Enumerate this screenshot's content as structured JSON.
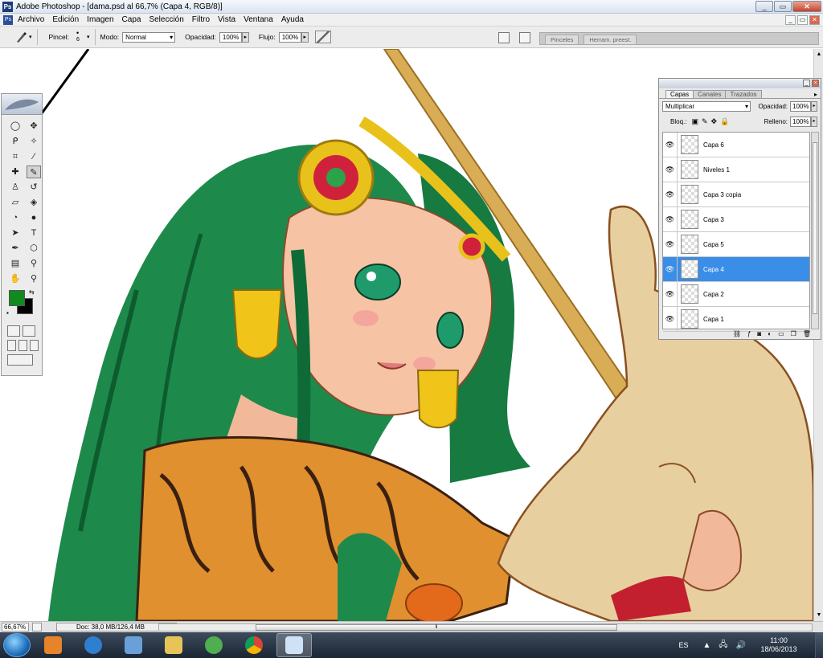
{
  "window": {
    "title": "Adobe Photoshop - [dama.psd al 66,7% (Capa 4, RGB/8)]",
    "controls": [
      "_",
      "▭",
      "✕"
    ]
  },
  "menubar": {
    "items": [
      "Archivo",
      "Edición",
      "Imagen",
      "Capa",
      "Selección",
      "Filtro",
      "Vista",
      "Ventana",
      "Ayuda"
    ],
    "doc_controls": [
      "_",
      "▭",
      "✕"
    ]
  },
  "options_bar": {
    "brush_label": "Pincel:",
    "brush_size": "6",
    "mode_label": "Modo:",
    "mode_value": "Normal",
    "opacity_label": "Opacidad:",
    "opacity_value": "100%",
    "flow_label": "Flujo:",
    "flow_value": "100%",
    "well_tabs": [
      "Pinceles",
      "Herram. preest."
    ]
  },
  "toolbox": {
    "foreground_color": "#118a1f",
    "background_color": "#000000",
    "tools": [
      {
        "icon": "marquee-icon",
        "glyph": "◯"
      },
      {
        "icon": "move-icon",
        "glyph": "✥"
      },
      {
        "icon": "lasso-icon",
        "glyph": "ᑭ"
      },
      {
        "icon": "magic-wand-icon",
        "glyph": "✧"
      },
      {
        "icon": "crop-icon",
        "glyph": "⌗"
      },
      {
        "icon": "slice-icon",
        "glyph": "⁄"
      },
      {
        "icon": "healing-brush-icon",
        "glyph": "✚"
      },
      {
        "icon": "brush-icon",
        "glyph": "✎"
      },
      {
        "icon": "clone-stamp-icon",
        "glyph": "♙"
      },
      {
        "icon": "history-brush-icon",
        "glyph": "↺"
      },
      {
        "icon": "eraser-icon",
        "glyph": "▱"
      },
      {
        "icon": "paint-bucket-icon",
        "glyph": "◈"
      },
      {
        "icon": "blur-icon",
        "glyph": "◔"
      },
      {
        "icon": "dodge-icon",
        "glyph": "●"
      },
      {
        "icon": "path-select-icon",
        "glyph": "➤"
      },
      {
        "icon": "type-icon",
        "glyph": "T"
      },
      {
        "icon": "pen-icon",
        "glyph": "✒"
      },
      {
        "icon": "shape-icon",
        "glyph": "⬡"
      },
      {
        "icon": "notes-icon",
        "glyph": "▤"
      },
      {
        "icon": "eyedropper-icon",
        "glyph": "⚲"
      },
      {
        "icon": "hand-icon",
        "glyph": "✋"
      },
      {
        "icon": "zoom-icon",
        "glyph": "⚲"
      }
    ]
  },
  "layers_panel": {
    "tabs": [
      "Capas",
      "Canales",
      "Trazados"
    ],
    "blend_mode": "Multiplicar",
    "opacity_label": "Opacidad:",
    "opacity_value": "100%",
    "lock_label": "Bloq.:",
    "fill_label": "Relleno:",
    "fill_value": "100%",
    "layers": [
      {
        "name": "Capa 6",
        "selected": false
      },
      {
        "name": "Niveles 1",
        "selected": false
      },
      {
        "name": "Capa 3 copia",
        "selected": false
      },
      {
        "name": "Capa 3",
        "selected": false
      },
      {
        "name": "Capa 5",
        "selected": false
      },
      {
        "name": "Capa 4",
        "selected": true
      },
      {
        "name": "Capa 2",
        "selected": false
      },
      {
        "name": "Capa 1",
        "selected": false
      }
    ]
  },
  "status_bar": {
    "zoom": "66,67%",
    "doc_info": "Doc: 38,0 MB/126,4 MB"
  },
  "taskbar": {
    "language": "ES",
    "time": "11:00",
    "date": "18/06/2013"
  },
  "colors": {
    "hair": "#1d8a4b",
    "skin": "#f6c3a4",
    "horn": "#d9ad55",
    "unicorn": "#e8cfa0",
    "dress": "#e0902e",
    "selection": "#3a8ee8"
  }
}
